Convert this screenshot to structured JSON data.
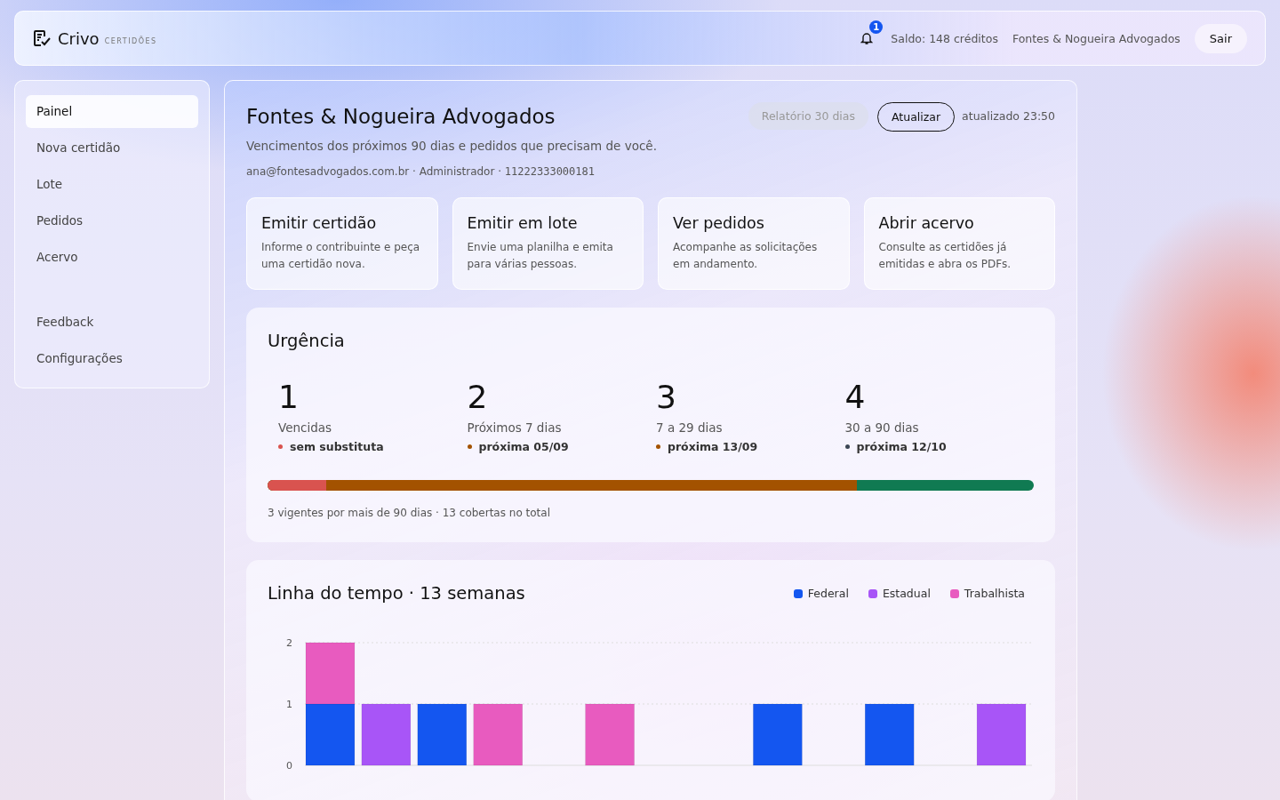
{
  "header": {
    "brand": "Crivo",
    "brand_sub": "CERTIDÕES",
    "notification_count": "1",
    "balance": "Saldo: 148 créditos",
    "account": "Fontes & Nogueira Advogados",
    "logout": "Sair"
  },
  "sidebar": {
    "items": [
      {
        "label": "Painel",
        "selected": true
      },
      {
        "label": "Nova certidão",
        "selected": false
      },
      {
        "label": "Lote",
        "selected": false
      },
      {
        "label": "Pedidos",
        "selected": false
      },
      {
        "label": "Acervo",
        "selected": false
      }
    ],
    "secondary_items": [
      {
        "label": "Feedback",
        "selected": false
      },
      {
        "label": "Configurações",
        "selected": false
      }
    ]
  },
  "main": {
    "title": "Fontes & Nogueira Advogados",
    "subtitle": "Vencimentos dos próximos 90 dias e pedidos que precisam de você.",
    "meta": "ana@fontesadvogados.com.br · Administrador · ",
    "tax_id": "11222333000181",
    "report_button": {
      "label": "Relatório 30 dias",
      "disabled": true
    },
    "refresh_button": "Atualizar",
    "updated": "atualizado 23:50",
    "actions": [
      {
        "title": "Emitir certidão",
        "description": "Informe o contribuinte e peça uma certidão nova."
      },
      {
        "title": "Emitir em lote",
        "description": "Envie uma planilha e emita para várias pessoas."
      },
      {
        "title": "Ver pedidos",
        "description": "Acompanhe as solicitações em andamento."
      },
      {
        "title": "Abrir acervo",
        "description": "Consulte as certidões já emitidas e abra os PDFs."
      }
    ],
    "urgency": {
      "title": "Urgência",
      "buckets": [
        {
          "count": "1",
          "label": "Vencidas",
          "note": "sem substituta",
          "color": "#d9534f"
        },
        {
          "count": "2",
          "label": "Próximos 7 dias",
          "note": "próxima 05/09",
          "color": "#a35200"
        },
        {
          "count": "3",
          "label": "7 a 29 dias",
          "note": "próxima 13/09",
          "color": "#a35200"
        },
        {
          "count": "4",
          "label": "30 a 90 dias",
          "note": "próxima 12/10",
          "color": "#3b4654"
        }
      ],
      "bar_track": {
        "color": "#107a52"
      },
      "bar": [
        {
          "level": 0.077,
          "color": "#d9534f"
        },
        {
          "level": 0.769,
          "color": "#a35200"
        }
      ],
      "footnote": "3 vigentes por mais de 90 dias · 13 cobertas no total"
    },
    "timeline": {
      "title": "Linha do tempo · 13 semanas",
      "chart_data": {
        "type": "bar",
        "stacked": true,
        "ylim": [
          0,
          2
        ],
        "yticks": [
          0,
          1,
          2
        ],
        "series": [
          {
            "name": "Federal",
            "color": "#1456f0",
            "values": [
              1,
              0,
              1,
              0,
              0,
              0,
              0,
              0,
              1,
              0,
              1,
              0,
              0
            ]
          },
          {
            "name": "Estadual",
            "color": "#a855f7",
            "values": [
              0,
              1,
              0,
              0,
              0,
              0,
              0,
              0,
              0,
              0,
              0,
              0,
              1
            ]
          },
          {
            "name": "Trabalhista",
            "color": "#e85bbf",
            "values": [
              1,
              0,
              0,
              1,
              0,
              1,
              0,
              0,
              0,
              0,
              0,
              0,
              0
            ]
          }
        ]
      }
    }
  }
}
